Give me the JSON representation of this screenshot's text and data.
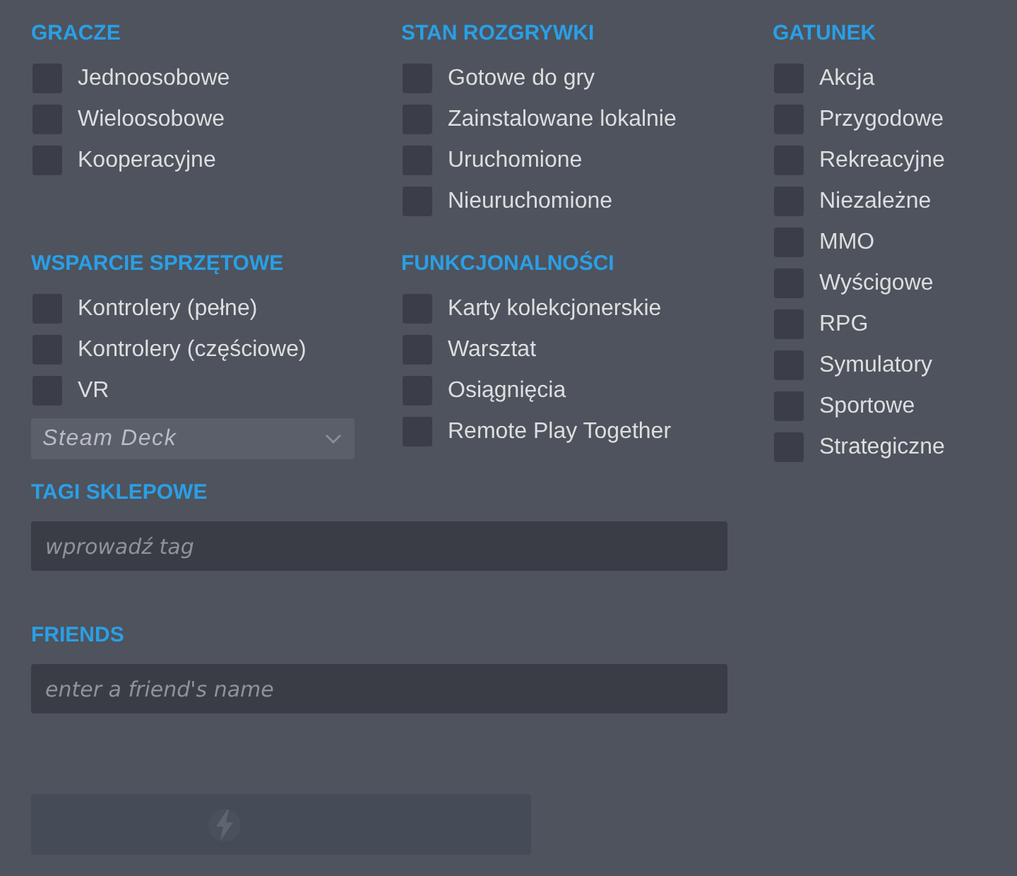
{
  "players": {
    "title": "GRACZE",
    "items": [
      {
        "label": "Jednoosobowe",
        "checked": false
      },
      {
        "label": "Wieloosobowe",
        "checked": false
      },
      {
        "label": "Kooperacyjne",
        "checked": false
      }
    ]
  },
  "play_state": {
    "title": "STAN ROZGRYWKI",
    "items": [
      {
        "label": "Gotowe do gry",
        "checked": false
      },
      {
        "label": "Zainstalowane lokalnie",
        "checked": false
      },
      {
        "label": "Uruchomione",
        "checked": false
      },
      {
        "label": "Nieuruchomione",
        "checked": false
      }
    ]
  },
  "genres": {
    "title": "GATUNEK",
    "items": [
      {
        "label": "Akcja",
        "checked": false
      },
      {
        "label": "Przygodowe",
        "checked": false
      },
      {
        "label": "Rekreacyjne",
        "checked": false
      },
      {
        "label": "Niezależne",
        "checked": false
      },
      {
        "label": "MMO",
        "checked": false
      },
      {
        "label": "Wyścigowe",
        "checked": false
      },
      {
        "label": "RPG",
        "checked": false
      },
      {
        "label": "Symulatory",
        "checked": false
      },
      {
        "label": "Sportowe",
        "checked": false
      },
      {
        "label": "Strategiczne",
        "checked": false
      }
    ]
  },
  "hardware_support": {
    "title": "WSPARCIE SPRZĘTOWE",
    "items": [
      {
        "label": "Kontrolery (pełne)",
        "checked": false
      },
      {
        "label": "Kontrolery (częściowe)",
        "checked": false
      },
      {
        "label": "VR",
        "checked": false
      }
    ],
    "dropdown": {
      "value": "Steam Deck"
    }
  },
  "features": {
    "title": "FUNKCJONALNOŚCI",
    "items": [
      {
        "label": "Karty kolekcjonerskie",
        "checked": false
      },
      {
        "label": "Warsztat",
        "checked": false
      },
      {
        "label": "Osiągnięcia",
        "checked": false
      },
      {
        "label": "Remote Play Together",
        "checked": false
      }
    ]
  },
  "store_tags": {
    "title": "TAGI SKLEPOWE",
    "placeholder": "wprowadź tag"
  },
  "friends": {
    "title": "FRIENDS",
    "placeholder": "enter a friend's name"
  },
  "action_button": {
    "disabled": true
  }
}
